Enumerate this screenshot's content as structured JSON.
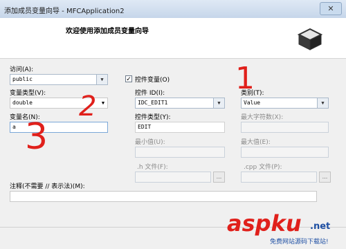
{
  "window": {
    "title": "添加成员变量向导 - MFCApplication2",
    "close_glyph": "✕"
  },
  "header": {
    "heading": "欢迎使用添加成员变量向导"
  },
  "form": {
    "access_label": "访问(A):",
    "access_value": "public",
    "control_var_label": "控件变量(O)",
    "control_var_checked": true,
    "var_type_label": "变量类型(V):",
    "var_type_value": "double",
    "control_id_label": "控件 ID(I):",
    "control_id_value": "IDC_EDIT1",
    "category_label": "类别(T):",
    "category_value": "Value",
    "var_name_label": "变量名(N):",
    "var_name_value": "a",
    "control_type_label": "控件类型(Y):",
    "control_type_value": "EDIT",
    "max_chars_label": "最大字符数(X):",
    "min_value_label": "最小值(U):",
    "max_value_label": "最大值(E):",
    "h_file_label": ".h 文件(F):",
    "cpp_file_label": ".cpp 文件(P):",
    "browse_label": "...",
    "comment_label": "注释(不需要 // 表示法)(M):"
  },
  "annotations": {
    "num1": "1",
    "num2": "2",
    "num3": "3"
  },
  "watermark": {
    "brand": "aspku",
    "tld": ".net",
    "tagline": "免费网站源码下载站!"
  },
  "colors": {
    "annotation": "#e0201b",
    "brand_blue": "#1e4fa3"
  }
}
